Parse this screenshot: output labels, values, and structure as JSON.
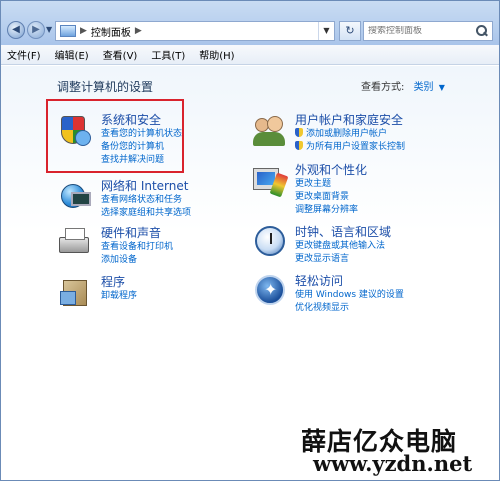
{
  "window": {
    "address_crumb": "控制面板",
    "search_placeholder": "搜索控制面板"
  },
  "menu": [
    "文件(F)",
    "编辑(E)",
    "查看(V)",
    "工具(T)",
    "帮助(H)"
  ],
  "page": {
    "title": "调整计算机的设置",
    "view_by_label": "查看方式:",
    "view_by_value": "类别"
  },
  "categories": [
    {
      "title": "系统和安全",
      "links": [
        "查看您的计算机状态",
        "备份您的计算机",
        "查找并解决问题"
      ]
    },
    {
      "title": "网络和 Internet",
      "links": [
        "查看网络状态和任务",
        "选择家庭组和共享选项"
      ]
    },
    {
      "title": "硬件和声音",
      "links": [
        "查看设备和打印机",
        "添加设备"
      ]
    },
    {
      "title": "程序",
      "links": [
        "卸载程序"
      ]
    },
    {
      "title": "用户帐户和家庭安全",
      "links": [
        "添加或删除用户帐户",
        "为所有用户设置家长控制"
      ]
    },
    {
      "title": "外观和个性化",
      "links": [
        "更改主题",
        "更改桌面背景",
        "调整屏幕分辨率"
      ]
    },
    {
      "title": "时钟、语言和区域",
      "links": [
        "更改键盘或其他输入法",
        "更改显示语言"
      ]
    },
    {
      "title": "轻松访问",
      "links": [
        "使用 Windows 建议的设置",
        "优化视频显示"
      ]
    }
  ],
  "watermark": {
    "line1": "薛店亿众电脑",
    "line2": "www.yzdn.net"
  }
}
